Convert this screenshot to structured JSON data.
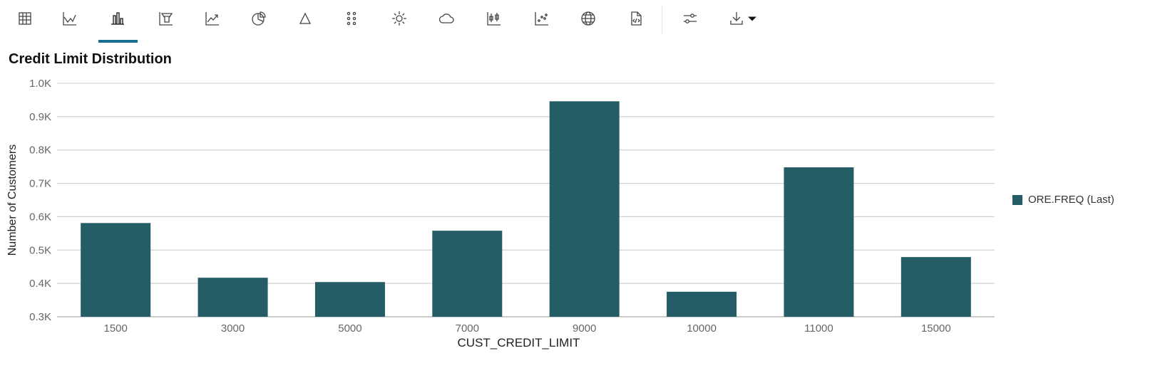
{
  "toolbar": {
    "icons": [
      "table-icon",
      "line-chart-icon",
      "bar-chart-icon",
      "funnel-icon",
      "trend-chart-icon",
      "pie-chart-icon",
      "triangle-icon",
      "dots-grid-icon",
      "sun-icon",
      "cloud-icon",
      "candlestick-icon",
      "scatter-icon",
      "globe-icon",
      "code-file-icon",
      "settings-sliders-icon",
      "download-icon"
    ],
    "selected": "bar-chart-icon"
  },
  "title": "Credit Limit Distribution",
  "colors": {
    "bar": "#245d65",
    "accent": "#1a6e8e"
  },
  "chart_data": {
    "type": "bar",
    "title": "Credit Limit Distribution",
    "xlabel": "CUST_CREDIT_LIMIT",
    "ylabel": "Number of Customers",
    "categories": [
      "1500",
      "3000",
      "5000",
      "7000",
      "9000",
      "10000",
      "11000",
      "15000"
    ],
    "series": [
      {
        "name": "ORE.FREQ (Last)",
        "values": [
          581,
          417,
          404,
          558,
          946,
          375,
          748,
          479
        ]
      }
    ],
    "ylim": [
      300,
      1000
    ],
    "yticks": [
      "0.3K",
      "0.4K",
      "0.5K",
      "0.6K",
      "0.7K",
      "0.8K",
      "0.9K",
      "1.0K"
    ],
    "grid": true,
    "legend": "right"
  }
}
